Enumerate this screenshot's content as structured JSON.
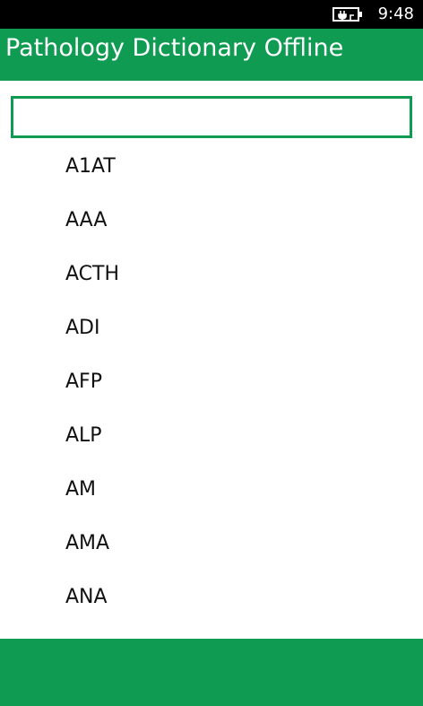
{
  "status_bar": {
    "time": "9:48",
    "icon": "battery-charging-icon"
  },
  "header": {
    "title": "Pathology Dictionary Offline"
  },
  "search": {
    "value": "",
    "placeholder": ""
  },
  "terms": {
    "items": [
      "A1AT",
      "AAA",
      "ACTH",
      "ADI",
      "AFP",
      "ALP",
      "AM",
      "AMA",
      "ANA"
    ]
  },
  "colors": {
    "accent": "#109b52",
    "status_bar": "#000000",
    "background": "#ffffff"
  }
}
